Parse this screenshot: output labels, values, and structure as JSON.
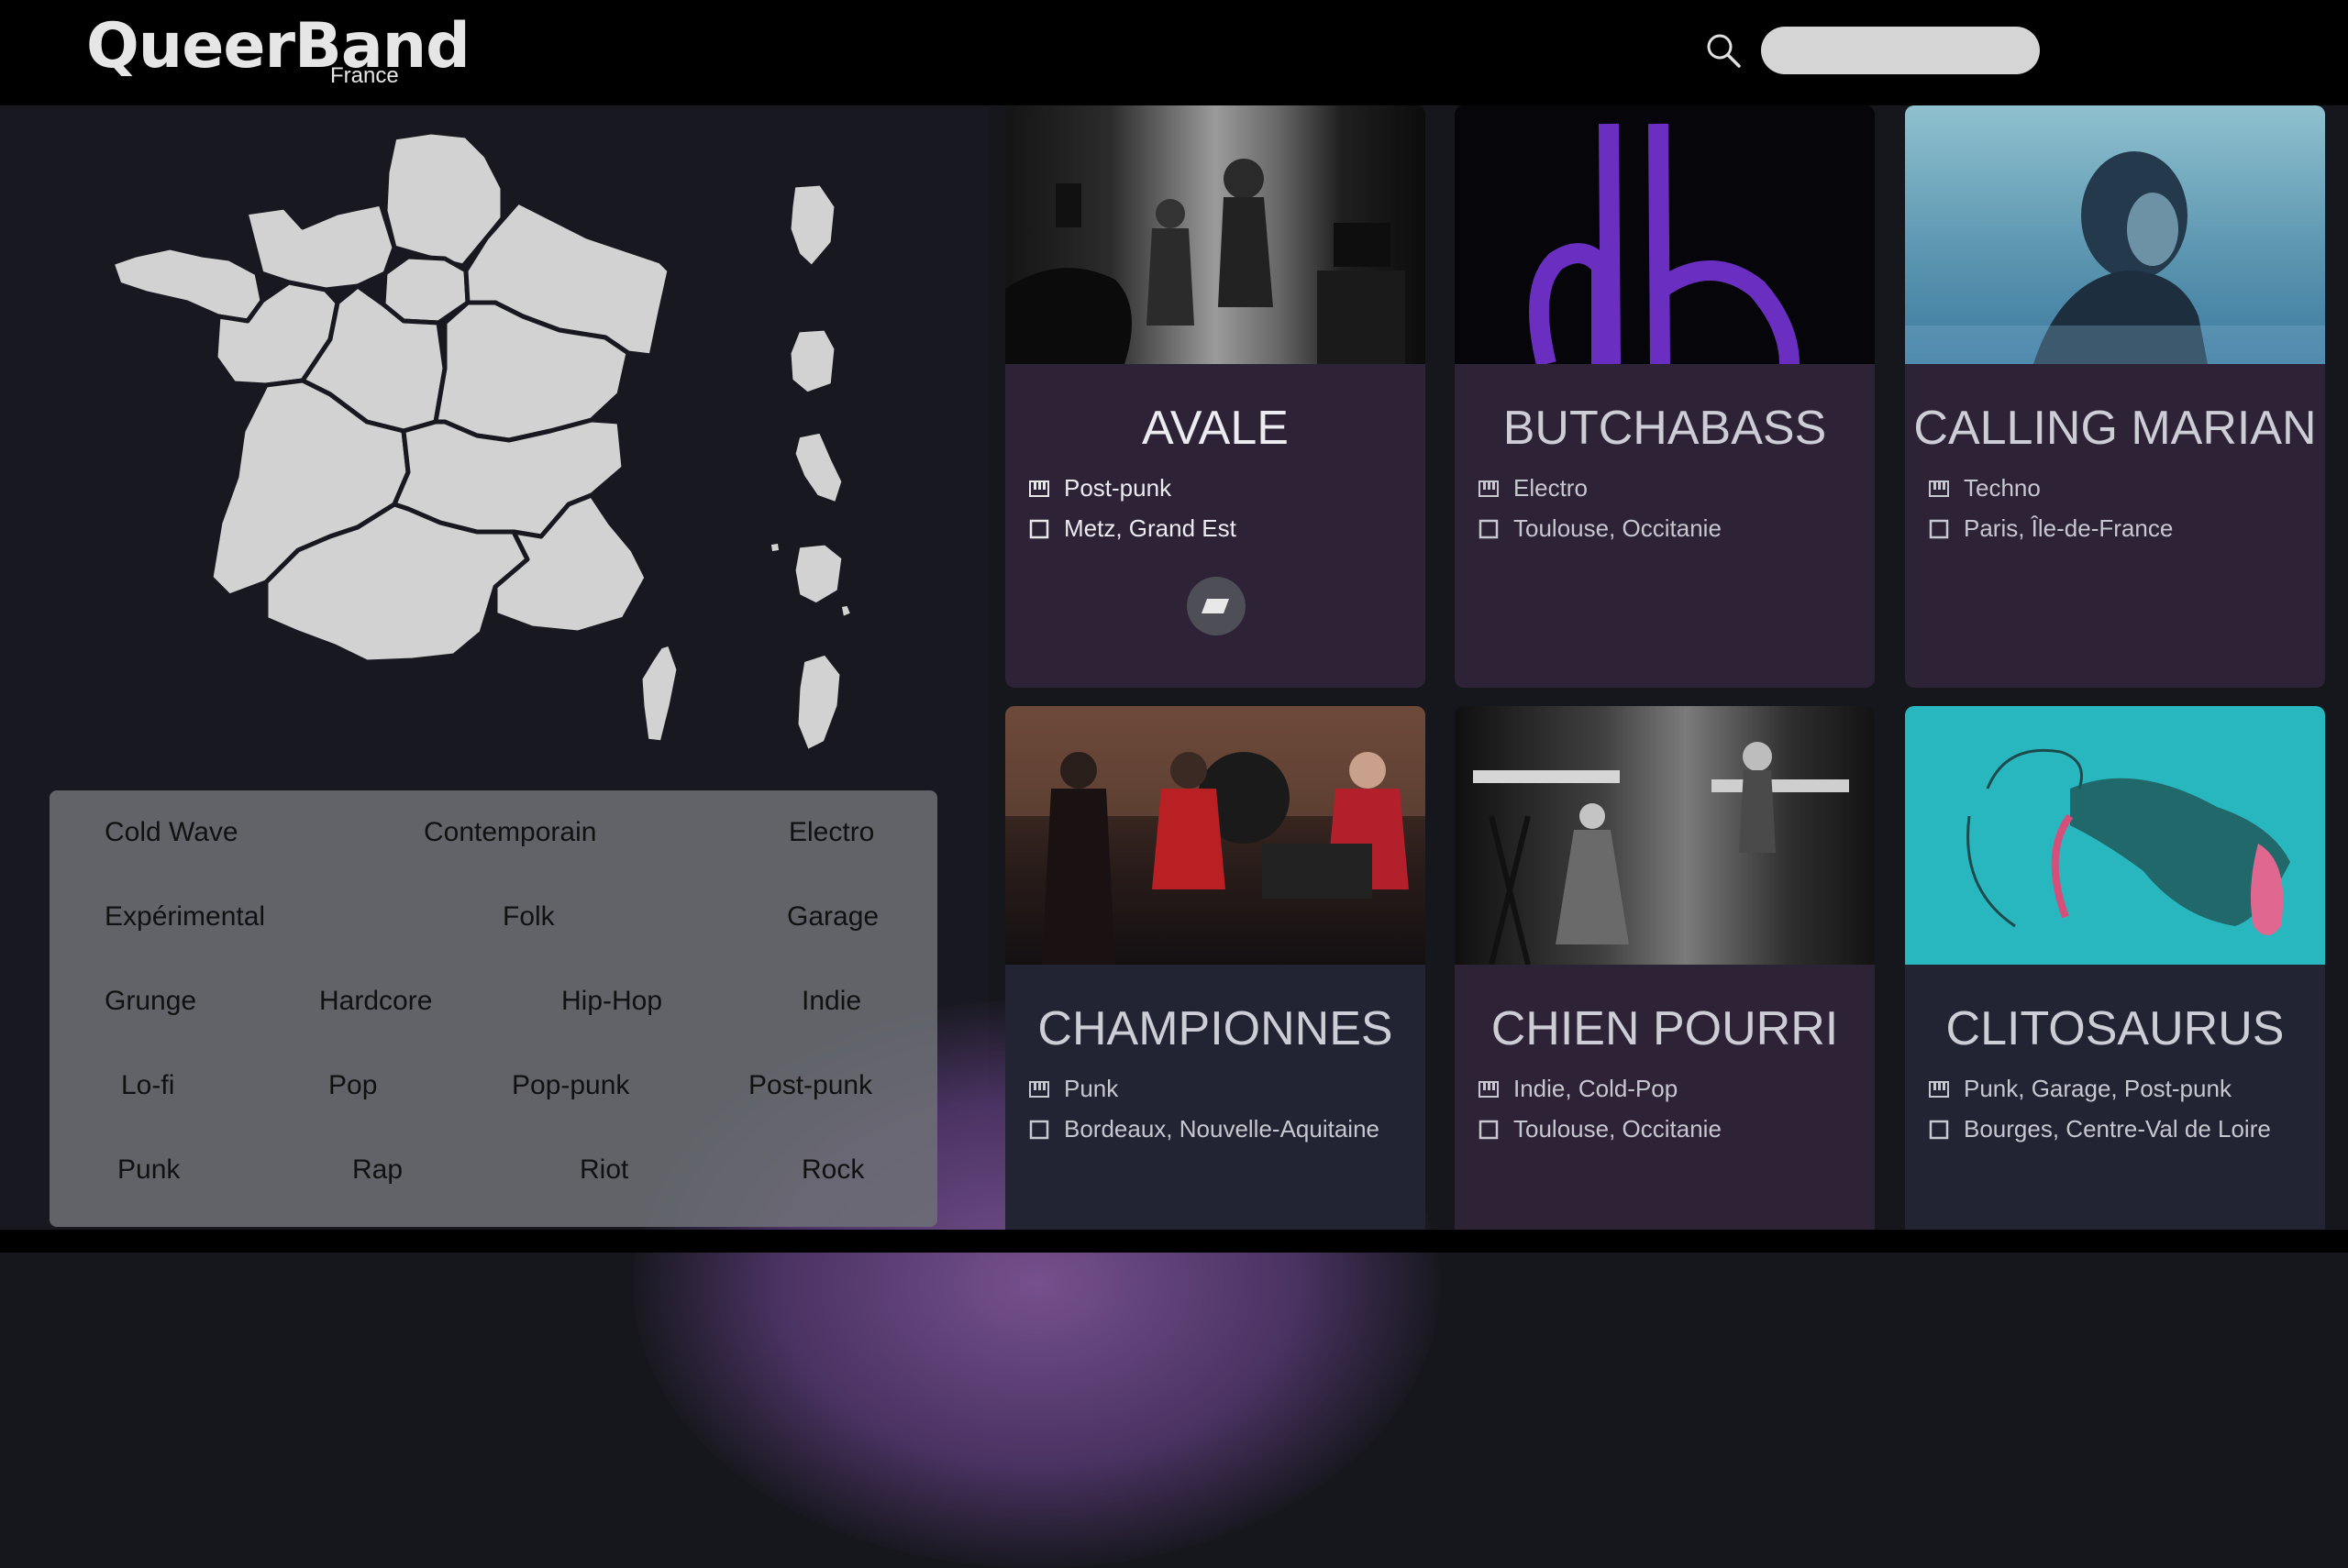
{
  "header": {
    "logo_main": "QueerBand",
    "logo_sub": "France",
    "search": {
      "placeholder": "",
      "value": ""
    }
  },
  "genres": [
    "Cold Wave",
    "Contemporain",
    "Electro",
    "Expérimental",
    "Folk",
    "Garage",
    "Grunge",
    "Hardcore",
    "Hip-Hop",
    "Indie",
    "Lo-fi",
    "Pop",
    "Pop-punk",
    "Post-punk",
    "Punk",
    "Rap",
    "Riot",
    "Rock"
  ],
  "bands": [
    {
      "name": "AVALE",
      "genres": "Post-punk",
      "location": "Metz, Grand Est",
      "photo": "black-and-white concert photo"
    },
    {
      "name": "BUTCHABASS",
      "genres": "Electro",
      "location": "Toulouse, Occitanie",
      "photo": "purple logo on black"
    },
    {
      "name": "CALLING MARIAN",
      "genres": "Techno",
      "location": "Paris, Île-de-France",
      "photo": "blue-tinted portrait"
    },
    {
      "name": "CHAMPIONNES",
      "genres": "Punk",
      "location": "Bordeaux, Nouvelle-Aquitaine",
      "photo": "live band in a bar"
    },
    {
      "name": "CHIEN POURRI",
      "genres": "Indie, Cold-Pop",
      "location": "Toulouse, Occitanie",
      "photo": "black-and-white studio photo"
    },
    {
      "name": "CLITOSAURUS",
      "genres": "Punk, Garage, Post-punk",
      "location": "Bourges, Centre-Val de Loire",
      "photo": "creature drawing on turquoise"
    }
  ],
  "icons": {
    "search": "search-icon",
    "genre": "piano-icon",
    "location": "square-icon",
    "favorite": "parallelogram-icon"
  },
  "colors": {
    "header_bg": "#000000",
    "page_bg": "#16171d",
    "card_purple": "#2e2237",
    "card_dark": "#232433",
    "accent_purple": "#6a2fc0",
    "turquoise": "#29b7bf"
  }
}
